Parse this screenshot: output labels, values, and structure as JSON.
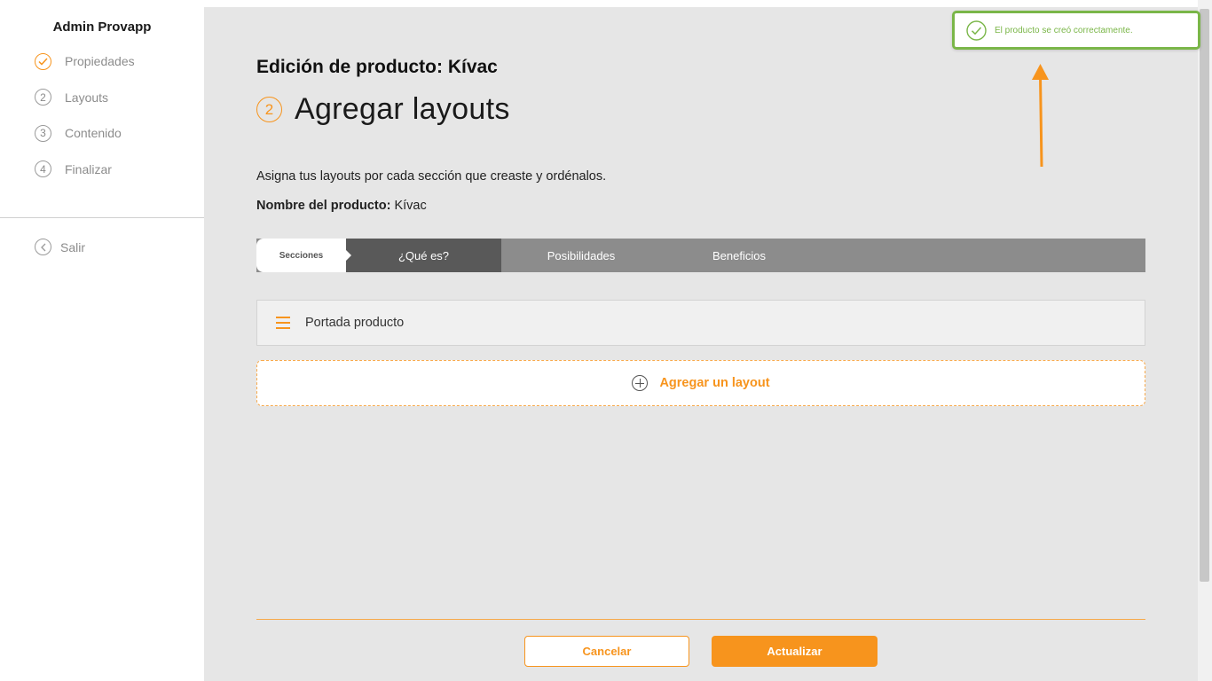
{
  "app": {
    "title": "Admin Provapp"
  },
  "sidebar": {
    "steps": [
      {
        "number": "",
        "label": "Propiedades",
        "state": "done"
      },
      {
        "number": "2",
        "label": "Layouts",
        "state": "pending"
      },
      {
        "number": "3",
        "label": "Contenido",
        "state": "pending"
      },
      {
        "number": "4",
        "label": "Finalizar",
        "state": "pending"
      }
    ],
    "exit_label": "Salir"
  },
  "main": {
    "title": "Edición de producto: Kívac",
    "step_number": "2",
    "step_heading": "Agregar layouts",
    "description": "Asigna tus layouts por cada sección que creaste y ordénalos.",
    "product_name_label": "Nombre del producto:",
    "product_name_value": "Kívac"
  },
  "tabs": {
    "sections_label": "Secciones",
    "items": [
      {
        "label": "¿Qué es?",
        "active": true
      },
      {
        "label": "Posibilidades",
        "active": false
      },
      {
        "label": "Beneficios",
        "active": false
      }
    ]
  },
  "layouts": [
    {
      "name": "Portada producto"
    }
  ],
  "add_layout_label": "Agregar un layout",
  "footer": {
    "cancel_label": "Cancelar",
    "update_label": "Actualizar"
  },
  "toast": {
    "message": "El producto se creó correctamente.",
    "type": "success"
  },
  "colors": {
    "accent": "#f7941d",
    "success": "#7ab648",
    "tab_active": "#595959",
    "tab_bar": "#8c8c8c",
    "main_bg": "#e6e6e6"
  }
}
